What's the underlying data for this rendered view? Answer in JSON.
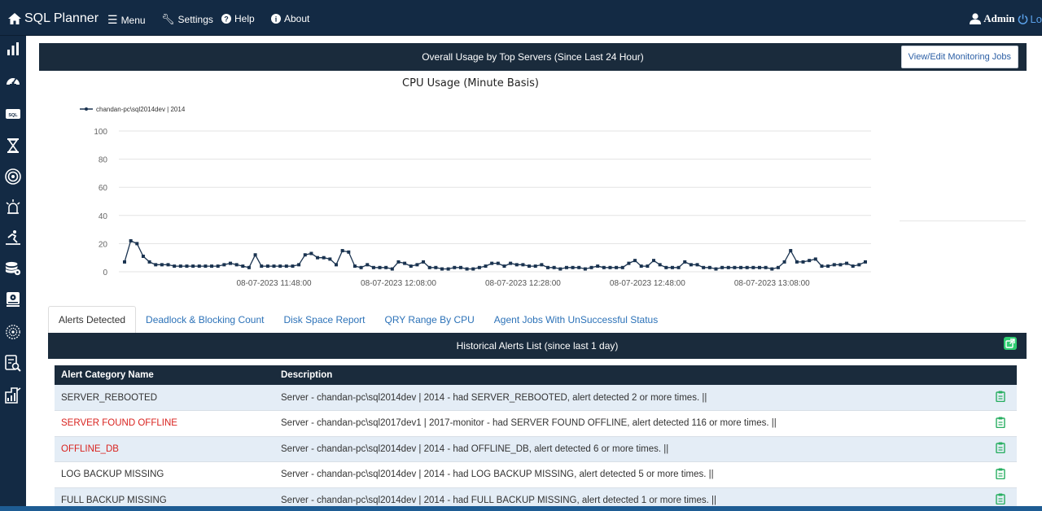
{
  "topbar": {
    "brand": "SQL Planner",
    "menu": "Menu",
    "settings": "Settings",
    "help": "Help",
    "about": "About",
    "user": "Admin",
    "logout": "Lo"
  },
  "panel": {
    "title": "Overall Usage by Top Servers (Since Last 24 Hour)",
    "button": "View/Edit Monitoring Jobs"
  },
  "chart_data": {
    "type": "line",
    "title": "CPU Usage (Minute Basis)",
    "ylim": [
      0,
      100
    ],
    "yticks": [
      0,
      20,
      40,
      60,
      80,
      100
    ],
    "xtick_labels": [
      "08-07-2023 11:48:00",
      "08-07-2023 12:08:00",
      "08-07-2023 12:28:00",
      "08-07-2023 12:48:00",
      "08-07-2023 13:08:00"
    ],
    "xtick_indices": [
      24,
      44,
      64,
      84,
      104
    ],
    "legend_position": "top-left",
    "grid": true,
    "series": [
      {
        "name": "chandan-pc\\sql2014dev | 2014",
        "color": "#1a3350",
        "values": [
          7,
          22,
          20,
          11,
          7,
          5,
          5,
          5,
          4,
          4,
          4,
          4,
          4,
          4,
          4,
          4,
          5,
          6,
          5,
          4,
          3,
          12,
          4,
          4,
          4,
          4,
          4,
          4,
          5,
          12,
          13,
          10,
          10,
          9,
          5,
          15,
          14,
          4,
          3,
          5,
          3,
          3,
          3,
          2,
          7,
          6,
          4,
          5,
          7,
          3,
          3,
          2,
          2,
          3,
          3,
          2,
          2,
          3,
          4,
          6,
          6,
          4,
          6,
          5,
          5,
          4,
          4,
          5,
          3,
          3,
          2,
          3,
          3,
          3,
          2,
          3,
          4,
          3,
          3,
          3,
          3,
          6,
          8,
          4,
          4,
          8,
          5,
          3,
          3,
          3,
          7,
          5,
          5,
          3,
          3,
          2,
          3,
          3,
          3,
          3,
          3,
          3,
          3,
          3,
          2,
          3,
          7,
          15,
          7,
          7,
          8,
          9,
          4,
          4,
          5,
          5,
          6,
          4,
          5,
          7
        ]
      }
    ]
  },
  "tabs": [
    "Alerts Detected",
    "Deadlock & Blocking Count",
    "Disk Space Report",
    "QRY Range By CPU",
    "Agent Jobs With UnSuccessful Status"
  ],
  "alerts": {
    "title": "Historical Alerts List (since last 1 day)",
    "columns": [
      "Alert Category Name",
      "Description"
    ],
    "rows": [
      {
        "name": "SERVER_REBOOTED",
        "desc": "Server - chandan-pc\\sql2014dev | 2014 - had SERVER_REBOOTED, alert detected 2 or more times. ||",
        "severity_color": "#333333"
      },
      {
        "name": "SERVER FOUND OFFLINE",
        "desc": "Server - chandan-pc\\sql2017dev1 | 2017-monitor - had SERVER FOUND OFFLINE, alert detected 116 or more times. ||",
        "severity_color": "#d9231f"
      },
      {
        "name": "OFFLINE_DB",
        "desc": "Server - chandan-pc\\sql2014dev | 2014 - had OFFLINE_DB, alert detected 6 or more times. ||",
        "severity_color": "#d9231f"
      },
      {
        "name": "LOG BACKUP MISSING",
        "desc": "Server - chandan-pc\\sql2014dev | 2014 - had LOG BACKUP MISSING, alert detected 5 or more times. ||",
        "severity_color": "#333333"
      },
      {
        "name": "FULL BACKUP MISSING",
        "desc": "Server - chandan-pc\\sql2014dev | 2014 - had FULL BACKUP MISSING, alert detected 1 or more times. ||",
        "severity_color": "#333333"
      }
    ]
  },
  "icons": {
    "sidebar": [
      "bar-chart-icon",
      "dashboard-gauge-icon",
      "sql-icon",
      "hourglass-icon",
      "target-icon",
      "alarm-icon",
      "performance-icon",
      "database-icon",
      "hard-drive-icon",
      "gears-icon",
      "report-search-icon",
      "report-chart-icon"
    ],
    "row_action": "clipboard-icon"
  }
}
